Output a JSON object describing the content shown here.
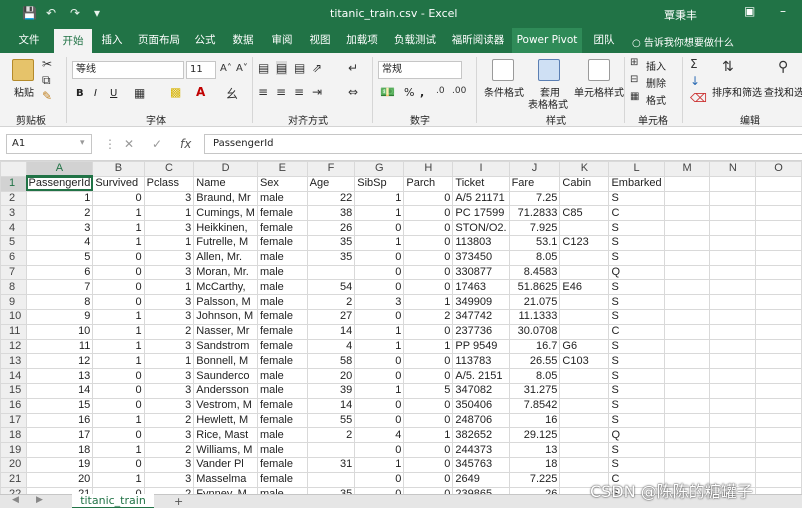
{
  "titlebar": {
    "title": "titanic_train.csv - Excel",
    "user": "覃秉丰",
    "save_icon": "save-icon",
    "undo_icon": "undo-icon",
    "redo_icon": "redo-icon"
  },
  "tabs": [
    "文件",
    "开始",
    "插入",
    "页面布局",
    "公式",
    "数据",
    "审阅",
    "视图",
    "加载项",
    "负载测试",
    "福昕阅读器",
    "Power Pivot",
    "团队"
  ],
  "tellme": "告诉我你想要做什么",
  "ribbon": {
    "paste": "粘贴",
    "clipboard": "剪贴板",
    "font_name": "等线",
    "font_size": "11",
    "font_group": "字体",
    "bold": "B",
    "italic": "I",
    "underline": "U",
    "align_group": "对齐方式",
    "number_format": "常规",
    "percent": "%",
    "comma": ",",
    "number_group": "数字",
    "cond_format": "条件格式",
    "table_format_1": "套用",
    "table_format_2": "表格格式",
    "cell_style": "单元格样式",
    "style_group": "样式",
    "insert": "插入",
    "delete": "删除",
    "format": "格式",
    "cells_group": "单元格",
    "sort_filter": "排序和筛选",
    "find_select": "查找和选择",
    "edit_group": "编辑",
    "accent": "#217346"
  },
  "formulabar": {
    "namebox": "A1",
    "content": "PassengerId",
    "fx": "fx"
  },
  "grid": {
    "columns": [
      "A",
      "B",
      "C",
      "D",
      "E",
      "F",
      "G",
      "H",
      "I",
      "J",
      "K",
      "L",
      "M",
      "N",
      "O"
    ],
    "rows": [
      {
        "n": "1",
        "c": [
          "PassengerId",
          "Survived",
          "Pclass",
          "Name",
          "Sex",
          "Age",
          "SibSp",
          "Parch",
          "Ticket",
          "Fare",
          "Cabin",
          "Embarked",
          "",
          "",
          ""
        ]
      },
      {
        "n": "2",
        "c": [
          "1",
          "0",
          "3",
          "Braund, Mr",
          "male",
          "22",
          "1",
          "0",
          "A/5 21171",
          "7.25",
          "",
          "S",
          "",
          "",
          ""
        ]
      },
      {
        "n": "3",
        "c": [
          "2",
          "1",
          "1",
          "Cumings, M",
          "female",
          "38",
          "1",
          "0",
          "PC 17599",
          "71.2833",
          "C85",
          "C",
          "",
          "",
          ""
        ]
      },
      {
        "n": "4",
        "c": [
          "3",
          "1",
          "3",
          "Heikkinen,",
          "female",
          "26",
          "0",
          "0",
          "STON/O2.",
          "7.925",
          "",
          "S",
          "",
          "",
          ""
        ]
      },
      {
        "n": "5",
        "c": [
          "4",
          "1",
          "1",
          "Futrelle, M",
          "female",
          "35",
          "1",
          "0",
          "113803",
          "53.1",
          "C123",
          "S",
          "",
          "",
          ""
        ]
      },
      {
        "n": "6",
        "c": [
          "5",
          "0",
          "3",
          "Allen, Mr.",
          "male",
          "35",
          "0",
          "0",
          "373450",
          "8.05",
          "",
          "S",
          "",
          "",
          ""
        ]
      },
      {
        "n": "7",
        "c": [
          "6",
          "0",
          "3",
          "Moran, Mr.",
          "male",
          "",
          "0",
          "0",
          "330877",
          "8.4583",
          "",
          "Q",
          "",
          "",
          ""
        ]
      },
      {
        "n": "8",
        "c": [
          "7",
          "0",
          "1",
          "McCarthy,",
          "male",
          "54",
          "0",
          "0",
          "17463",
          "51.8625",
          "E46",
          "S",
          "",
          "",
          ""
        ]
      },
      {
        "n": "9",
        "c": [
          "8",
          "0",
          "3",
          "Palsson, M",
          "male",
          "2",
          "3",
          "1",
          "349909",
          "21.075",
          "",
          "S",
          "",
          "",
          ""
        ]
      },
      {
        "n": "10",
        "c": [
          "9",
          "1",
          "3",
          "Johnson, M",
          "female",
          "27",
          "0",
          "2",
          "347742",
          "11.1333",
          "",
          "S",
          "",
          "",
          ""
        ]
      },
      {
        "n": "11",
        "c": [
          "10",
          "1",
          "2",
          "Nasser, Mr",
          "female",
          "14",
          "1",
          "0",
          "237736",
          "30.0708",
          "",
          "C",
          "",
          "",
          ""
        ]
      },
      {
        "n": "12",
        "c": [
          "11",
          "1",
          "3",
          "Sandstrom",
          "female",
          "4",
          "1",
          "1",
          "PP 9549",
          "16.7",
          "G6",
          "S",
          "",
          "",
          ""
        ]
      },
      {
        "n": "13",
        "c": [
          "12",
          "1",
          "1",
          "Bonnell, M",
          "female",
          "58",
          "0",
          "0",
          "113783",
          "26.55",
          "C103",
          "S",
          "",
          "",
          ""
        ]
      },
      {
        "n": "14",
        "c": [
          "13",
          "0",
          "3",
          "Saunderco",
          "male",
          "20",
          "0",
          "0",
          "A/5. 2151",
          "8.05",
          "",
          "S",
          "",
          "",
          ""
        ]
      },
      {
        "n": "15",
        "c": [
          "14",
          "0",
          "3",
          "Andersson",
          "male",
          "39",
          "1",
          "5",
          "347082",
          "31.275",
          "",
          "S",
          "",
          "",
          ""
        ]
      },
      {
        "n": "16",
        "c": [
          "15",
          "0",
          "3",
          "Vestrom, M",
          "female",
          "14",
          "0",
          "0",
          "350406",
          "7.8542",
          "",
          "S",
          "",
          "",
          ""
        ]
      },
      {
        "n": "17",
        "c": [
          "16",
          "1",
          "2",
          "Hewlett, M",
          "female",
          "55",
          "0",
          "0",
          "248706",
          "16",
          "",
          "S",
          "",
          "",
          ""
        ]
      },
      {
        "n": "18",
        "c": [
          "17",
          "0",
          "3",
          "Rice, Mast",
          "male",
          "2",
          "4",
          "1",
          "382652",
          "29.125",
          "",
          "Q",
          "",
          "",
          ""
        ]
      },
      {
        "n": "19",
        "c": [
          "18",
          "1",
          "2",
          "Williams, M",
          "male",
          "",
          "0",
          "0",
          "244373",
          "13",
          "",
          "S",
          "",
          "",
          ""
        ]
      },
      {
        "n": "20",
        "c": [
          "19",
          "0",
          "3",
          "Vander Pl",
          "female",
          "31",
          "1",
          "0",
          "345763",
          "18",
          "",
          "S",
          "",
          "",
          ""
        ]
      },
      {
        "n": "21",
        "c": [
          "20",
          "1",
          "3",
          "Masselma",
          "female",
          "",
          "0",
          "0",
          "2649",
          "7.225",
          "",
          "C",
          "",
          "",
          ""
        ]
      },
      {
        "n": "22",
        "c": [
          "21",
          "0",
          "2",
          "Fynney, M",
          "male",
          "35",
          "0",
          "0",
          "239865",
          "26",
          "",
          "S",
          "",
          "",
          ""
        ]
      }
    ],
    "text_columns": [
      3,
      4,
      8,
      10,
      11
    ]
  },
  "sheet": {
    "tab": "titanic_train",
    "add": "+"
  },
  "watermark": "CSDN @陈陈的糖罐子"
}
